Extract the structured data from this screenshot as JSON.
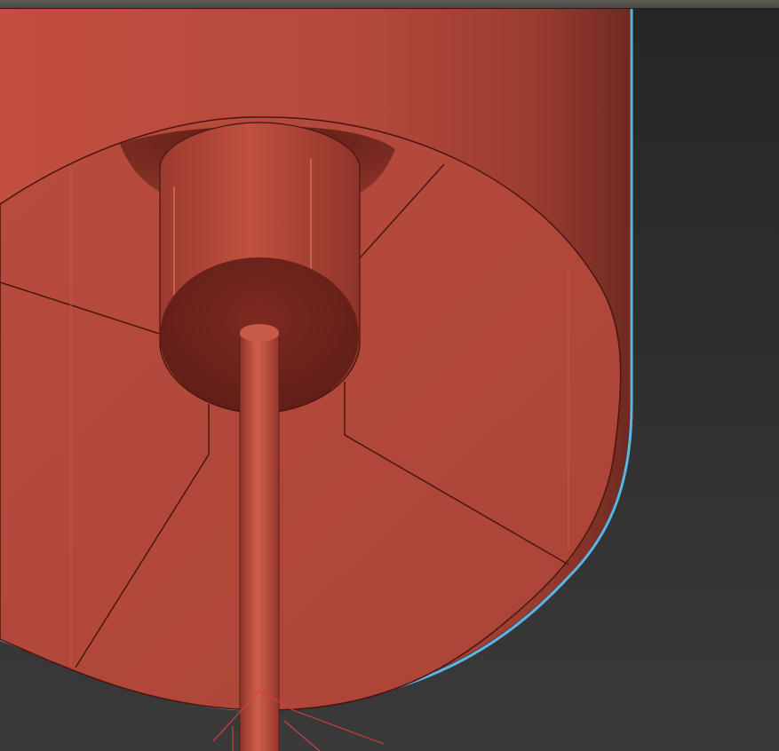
{
  "viewport": {
    "label": "",
    "background_top": "#262626",
    "background_bottom": "#3a3a3a",
    "strip_color": "#55554e"
  },
  "model": {
    "name": "red-cylinder-model",
    "base_color": "#b24a3c",
    "highlight_color": "#c85a48",
    "shadow_color": "#7a2a22",
    "selection_outline_color": "#5bb6e6",
    "edge_color": "#4a1510"
  },
  "gizmo": {
    "name": "transform-gizmo",
    "color": "#d04040"
  }
}
